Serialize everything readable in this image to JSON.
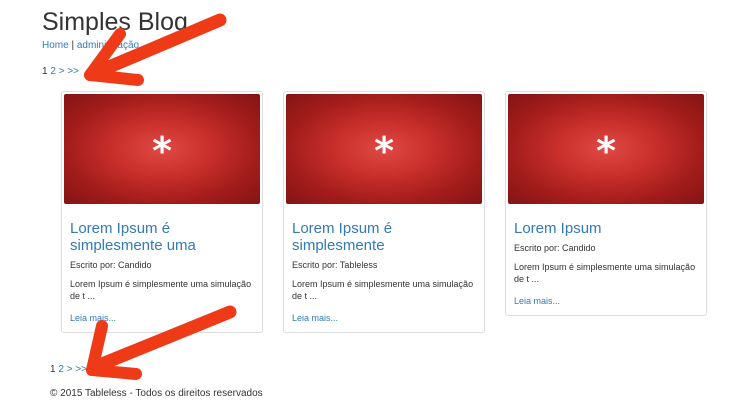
{
  "site": {
    "title": "Simples Blog"
  },
  "nav": {
    "home": "Home",
    "separator": " | ",
    "admin": "administração"
  },
  "pagination": {
    "current": "1",
    "page2": "2",
    "next": ">",
    "last": ">>"
  },
  "posts": [
    {
      "image_symbol": "*",
      "title": "Lorem Ipsum é simplesmente uma",
      "author": "Escrito por: Candido",
      "excerpt": "Lorem Ipsum é simplesmente uma simulação de t ...",
      "more": "Leia mais..."
    },
    {
      "image_symbol": "*",
      "title": "Lorem Ipsum é simplesmente",
      "author": "Escrito por: Tableless",
      "excerpt": "Lorem Ipsum é simplesmente uma simulação de t ...",
      "more": "Leia mais..."
    },
    {
      "image_symbol": "*",
      "title": "Lorem Ipsum",
      "author": "Escrito por: Candido",
      "excerpt": "Lorem Ipsum é simplesmente uma simulação de t ...",
      "more": "Leia mais..."
    }
  ],
  "footer": {
    "text": "© 2015 Tableless - Todos os direitos reservados"
  },
  "colors": {
    "arrow": "#ee3a16",
    "link": "#337ab7",
    "image": "#c0302c"
  },
  "icons": {
    "annotation_arrow": "red-arrow-icon"
  }
}
